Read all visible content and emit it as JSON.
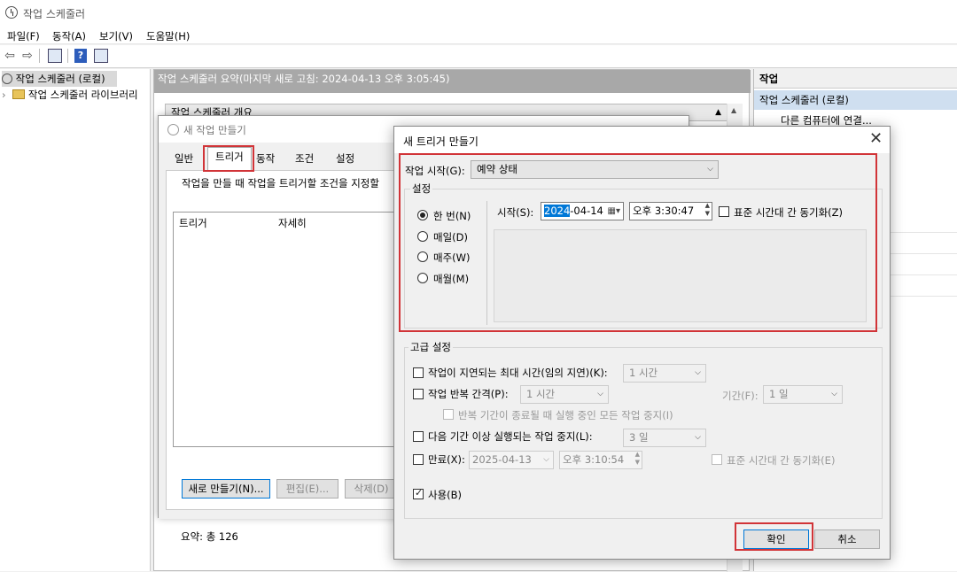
{
  "window": {
    "title": "작업 스케줄러",
    "menu": [
      "파일(F)",
      "동작(A)",
      "보기(V)",
      "도움말(H)"
    ]
  },
  "tree": {
    "items": [
      "작업 스케줄러 (로컬)",
      "작업 스케줄러 라이브러리"
    ]
  },
  "center": {
    "header": "작업 스케줄러 요약(마지막 새로 고침: 2024-04-13 오후 3:05:45)",
    "overview": "작업 스케줄러 개요",
    "summary": "요약: 총 126"
  },
  "actions": {
    "header": "작업",
    "selected": "작업 스케줄러 (로컬)",
    "connect": "다른 컴퓨터에 연결..."
  },
  "task_dialog": {
    "title": "새 작업 만들기",
    "tabs": [
      "일반",
      "트리거",
      "동작",
      "조건",
      "설정"
    ],
    "description": "작업을 만들 때 작업을 트리거할 조건을 지정할",
    "columns": [
      "트리거",
      "자세히"
    ],
    "buttons": {
      "new": "새로 만들기(N)...",
      "edit": "편집(E)...",
      "delete": "삭제(D)"
    }
  },
  "trigger_dialog": {
    "title": "새 트리거 만들기",
    "begin_label": "작업 시작(G):",
    "begin_value": "예약 상태",
    "settings_label": "설정",
    "radios": [
      "한 번(N)",
      "매일(D)",
      "매주(W)",
      "매월(M)"
    ],
    "start_label": "시작(S):",
    "start_date_sel": "2024",
    "start_date_rest": "-04-14",
    "start_time": "오후   3:30:47",
    "sync_label": "표준 시간대 간 동기화(Z)",
    "advanced_label": "고급 설정",
    "delay_label": "작업이 지연되는 최대 시간(임의 지연)(K):",
    "delay_value": "1 시간",
    "repeat_label": "작업 반복 간격(P):",
    "repeat_value": "1 시간",
    "duration_label": "기간(F):",
    "duration_value": "1 일",
    "stop_all_label": "반복 기간이 종료될 때 실행 중인 모든 작업 중지(I)",
    "stop_longer_label": "다음 기간 이상 실행되는 작업 중지(L):",
    "stop_longer_value": "3 일",
    "expire_label": "만료(X):",
    "expire_date": "2025-04-13",
    "expire_time": "오후   3:10:54",
    "expire_sync_label": "표준 시간대 간 동기화(E)",
    "enabled_label": "사용(B)",
    "ok": "확인",
    "cancel": "취소"
  },
  "colors": {
    "highlight": "#d13438",
    "focus": "#0078d7"
  }
}
